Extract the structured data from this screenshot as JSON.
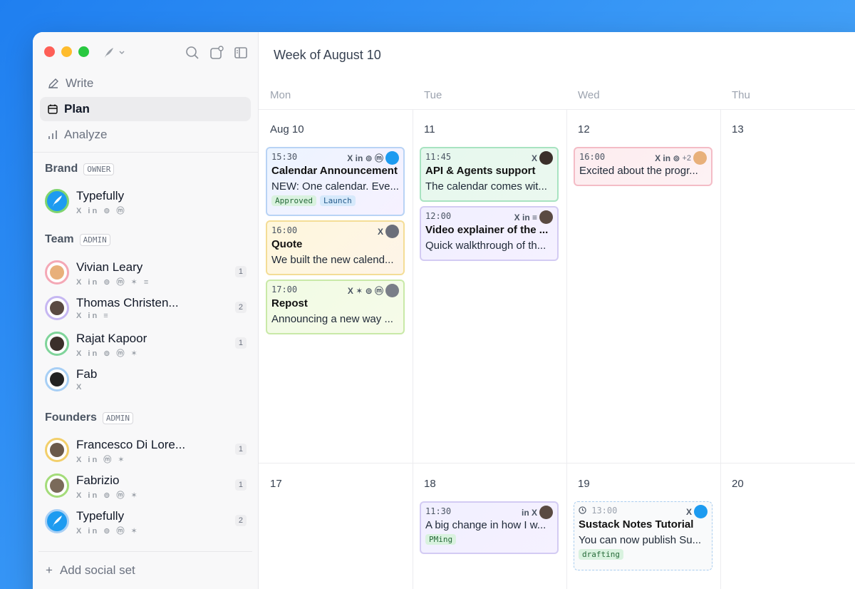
{
  "sidebar": {
    "nav": [
      {
        "label": "Write",
        "icon": "pencil-icon",
        "active": false
      },
      {
        "label": "Plan",
        "icon": "calendar-icon",
        "active": true
      },
      {
        "label": "Analyze",
        "icon": "bar-chart-icon",
        "active": false
      }
    ],
    "groups": [
      {
        "name": "Brand",
        "role": "OWNER",
        "accounts": [
          {
            "name": "Typefully",
            "platforms": "X in ⊚ ⓜ",
            "count": ""
          }
        ]
      },
      {
        "name": "Team",
        "role": "ADMIN",
        "accounts": [
          {
            "name": "Vivian Leary",
            "platforms": "X in ⊚ ⓜ ✶ ≡",
            "count": "1"
          },
          {
            "name": "Thomas Christen...",
            "platforms": "X in ≡",
            "count": "2"
          },
          {
            "name": "Rajat Kapoor",
            "platforms": "X in ⊚ ⓜ ✶",
            "count": "1"
          },
          {
            "name": "Fab",
            "platforms": "X",
            "count": ""
          }
        ]
      },
      {
        "name": "Founders",
        "role": "ADMIN",
        "accounts": [
          {
            "name": "Francesco Di Lore...",
            "platforms": "X in ⓜ ✶",
            "count": "1"
          },
          {
            "name": "Fabrizio",
            "platforms": "X in ⊚ ⓜ ✶",
            "count": "1"
          },
          {
            "name": "Typefully",
            "platforms": "X in ⊚ ⓜ ✶",
            "count": "2"
          }
        ]
      }
    ],
    "add_social_set": "Add social set"
  },
  "main": {
    "week_title": "Week of August 10",
    "weekdays": [
      "Mon",
      "Tue",
      "Wed",
      "Thu"
    ],
    "week1_days": [
      "Aug 10",
      "11",
      "12",
      "13"
    ],
    "week2_days": [
      "17",
      "18",
      "19",
      "20"
    ]
  },
  "cards": [
    {
      "time": "15:30",
      "icons": "X in ⊚ ⓜ",
      "title": "Calendar Announcement",
      "body": "NEW: One calendar. Eve...",
      "tags": [
        "Approved",
        "Launch"
      ]
    },
    {
      "time": "16:00",
      "icons": "X",
      "title": "Quote",
      "body": "We built the new calend...",
      "tags": []
    },
    {
      "time": "17:00",
      "icons": "X ✶ ⊚ ⓜ",
      "title": "Repost",
      "body": "Announcing a new way ...",
      "tags": []
    },
    {
      "time": "11:45",
      "icons": "X",
      "title": "API & Agents support",
      "body": "The calendar comes wit...",
      "tags": []
    },
    {
      "time": "12:00",
      "icons": "X in ≡",
      "title": "Video explainer of the ...",
      "body": "Quick walkthrough of th...",
      "tags": []
    },
    {
      "time": "16:00",
      "icons": "X in ⊚",
      "extra": "+2",
      "title": "",
      "body": "Excited about the progr...",
      "tags": []
    },
    {
      "time": "11:30",
      "icons": "in X",
      "title": "",
      "body": "A big change in how I w...",
      "tags": [
        "PMing"
      ]
    },
    {
      "time": "13:00",
      "icons": "X",
      "title": "Sustack Notes Tutorial",
      "body": "You can now publish Su...",
      "tags": [
        "drafting"
      ]
    }
  ],
  "colors": {
    "accent": "#1d9bf0",
    "background": "#3d9cf7"
  }
}
